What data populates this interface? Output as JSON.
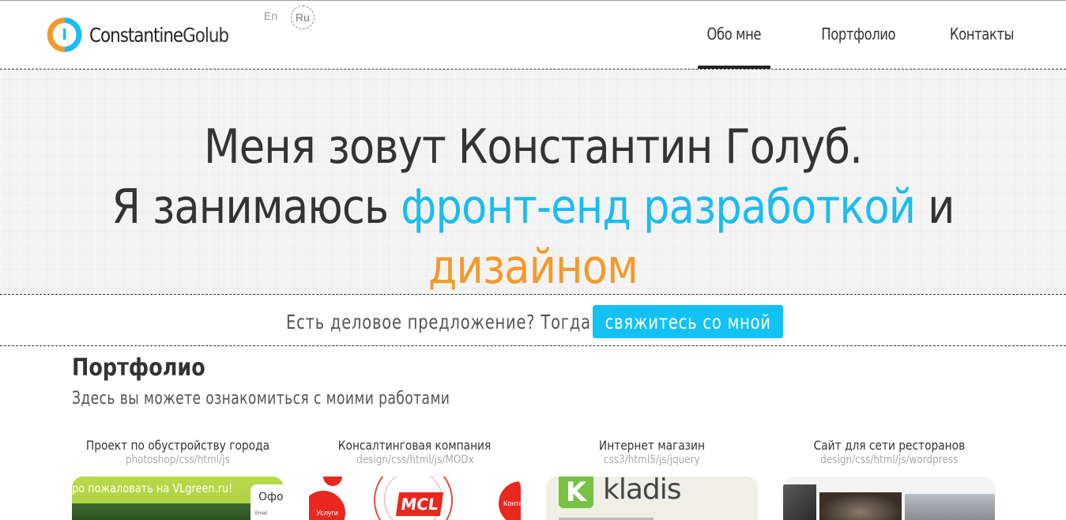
{
  "header": {
    "logo_bold": "Constantine",
    "logo_light": "Golub",
    "lang_en": "En",
    "lang_ru": "Ru",
    "nav": {
      "about": "Обо мне",
      "portfolio": "Портфолио",
      "contacts": "Контакты"
    }
  },
  "hero": {
    "line1": "Меня зовут Константин Голуб.",
    "line2_start": "Я занимаюсь ",
    "line2_blue": "фронт-енд разработкой",
    "line2_end": " и",
    "line3_orange": "дизайном"
  },
  "cta": {
    "text": "Есть деловое предложение? Тогда",
    "button": "свяжитесь со мной"
  },
  "portfolio": {
    "title": "Портфолио",
    "subtitle": "Здесь вы можете ознакомиться с моими работами",
    "items": [
      {
        "title": "Проект по обустройству города",
        "tags": "photoshop/css/html/js",
        "preview_banner": "ро пожаловать на VLgreen.ru!",
        "preview_panel": "Офор",
        "preview_email": "Email"
      },
      {
        "title": "Консалтинговая компания",
        "tags": "design/css/html/js/MODx",
        "preview_left": "Услуги",
        "preview_right": "Конта",
        "preview_logo": "MCL"
      },
      {
        "title": "Интернет магазин",
        "tags": "css3/html5/js/jquery",
        "preview_logo_letter": "K",
        "preview_logo_text": "kladis"
      },
      {
        "title": "Сайт для сети ресторанов",
        "tags": "design/css/html/js/wordpress"
      }
    ]
  },
  "colors": {
    "accent_blue": "#1bbcef",
    "accent_orange": "#f39a2c",
    "button_blue": "#13c2f2"
  }
}
